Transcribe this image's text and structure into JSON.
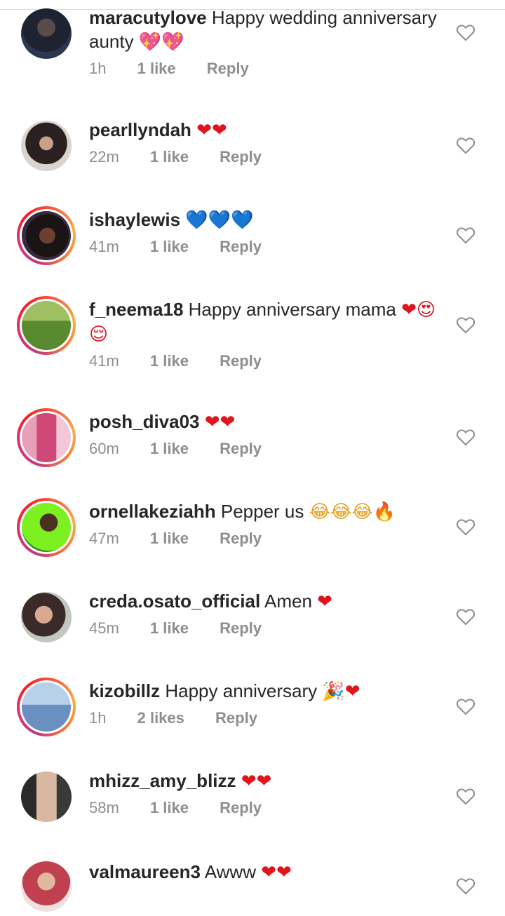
{
  "comments": [
    {
      "username": "maracutylove",
      "text": "Happy wedding anniversary aunty",
      "emojis": "💖💖",
      "time": "1h",
      "likes": "1 like",
      "reply": "Reply"
    },
    {
      "username": "pearllyndah",
      "text": "",
      "emojis": "❤❤",
      "time": "22m",
      "likes": "1 like",
      "reply": "Reply"
    },
    {
      "username": "ishaylewis",
      "text": "",
      "emojis": "💙💙💙",
      "time": "41m",
      "likes": "1 like",
      "reply": "Reply"
    },
    {
      "username": "f_neema18",
      "text": "Happy anniversary mama",
      "emojis": "❤😍😌",
      "time": "41m",
      "likes": "1 like",
      "reply": "Reply"
    },
    {
      "username": "posh_diva03",
      "text": "",
      "emojis": "❤❤",
      "time": "60m",
      "likes": "1 like",
      "reply": "Reply"
    },
    {
      "username": "ornellakeziahh",
      "text": "Pepper us",
      "emojis": "😂😂😂🔥",
      "time": "47m",
      "likes": "1 like",
      "reply": "Reply"
    },
    {
      "username": "creda.osato_official",
      "text": "Amen",
      "emojis": "❤",
      "time": "45m",
      "likes": "1 like",
      "reply": "Reply"
    },
    {
      "username": "kizobillz",
      "text": "Happy anniversary",
      "emojis": "🎉❤",
      "time": "1h",
      "likes": "2 likes",
      "reply": "Reply"
    },
    {
      "username": "mhizz_amy_blizz",
      "text": "",
      "emojis": "❤❤",
      "time": "58m",
      "likes": "1 like",
      "reply": "Reply"
    },
    {
      "username": "valmaureen3",
      "text": "Awww",
      "emojis": "❤❤",
      "time": "",
      "likes": "",
      "reply": ""
    }
  ],
  "icons": {
    "like": "heart-outline-icon"
  },
  "colors": {
    "text": "#262626",
    "meta": "#8e8e8e",
    "heart": "#e0141c",
    "blue_heart": "#1a8ce8",
    "story_ring": "#e1306c"
  }
}
